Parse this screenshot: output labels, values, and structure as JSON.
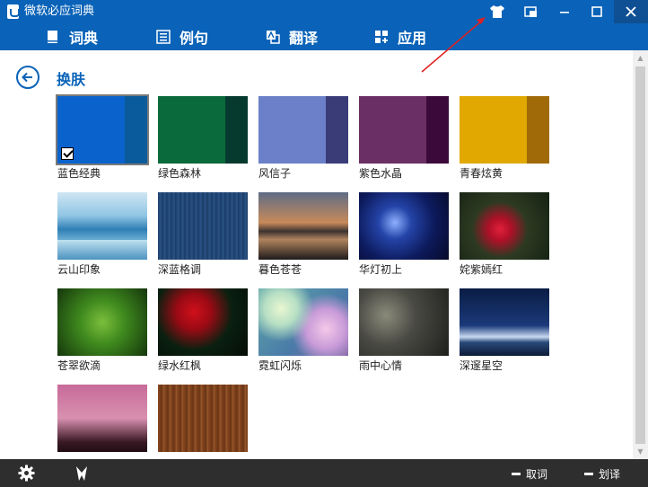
{
  "window": {
    "title": "微软必应词典"
  },
  "nav": {
    "items": [
      {
        "label": "词典",
        "icon": "book-icon"
      },
      {
        "label": "例句",
        "icon": "list-icon"
      },
      {
        "label": "翻译",
        "icon": "translate-icon"
      },
      {
        "label": "应用",
        "icon": "apps-icon"
      }
    ]
  },
  "page": {
    "title": "换肤"
  },
  "skins": [
    {
      "label": "蓝色经典",
      "selected": true,
      "colors": [
        "#0a63cc",
        "#0a5b9b"
      ]
    },
    {
      "label": "绿色森林",
      "selected": false,
      "colors": [
        "#0a6a3b",
        "#063a2e"
      ]
    },
    {
      "label": "风信子",
      "selected": false,
      "colors": [
        "#6b80c8",
        "#3a3c78"
      ]
    },
    {
      "label": "紫色水晶",
      "selected": false,
      "colors": [
        "#6a2f64",
        "#3c0a3a"
      ]
    },
    {
      "label": "青春炫黄",
      "selected": false,
      "colors": [
        "#e0a800",
        "#a06a08"
      ]
    },
    {
      "label": "云山印象",
      "selected": false
    },
    {
      "label": "深蓝格调",
      "selected": false
    },
    {
      "label": "暮色苍苍",
      "selected": false
    },
    {
      "label": "华灯初上",
      "selected": false
    },
    {
      "label": "姹紫嫣红",
      "selected": false
    },
    {
      "label": "苍翠欲滴",
      "selected": false
    },
    {
      "label": "绿水红枫",
      "selected": false
    },
    {
      "label": "霓虹闪烁",
      "selected": false
    },
    {
      "label": "雨中心情",
      "selected": false
    },
    {
      "label": "深邃星空",
      "selected": false
    },
    {
      "label": "",
      "selected": false
    },
    {
      "label": "",
      "selected": false
    }
  ],
  "bottom": {
    "word_pick_label": "取词",
    "selection_translate_label": "划译"
  },
  "colors": {
    "accent": "#0a63b8",
    "bottom_bar": "#2e2e2e",
    "annotation": "#e02020"
  }
}
